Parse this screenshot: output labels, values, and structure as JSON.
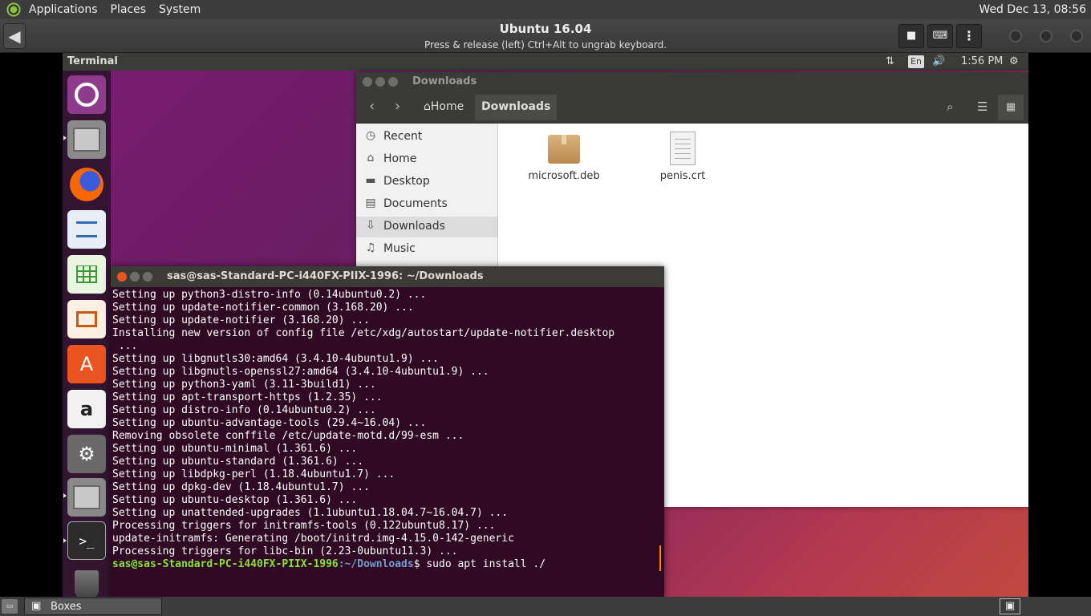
{
  "host_panel": {
    "menus": [
      "Applications",
      "Places",
      "System"
    ],
    "clock": "Wed Dec 13, 08:56"
  },
  "boxes_header": {
    "back_icon": "◀",
    "title": "Ubuntu 16.04",
    "subtitle": "Press & release (left) Ctrl+Alt to ungrab keyboard.",
    "buttons": {
      "stop": "■",
      "keyboard": "⌨",
      "menu": "⋮"
    }
  },
  "guest_panel": {
    "app_title": "Terminal",
    "network_icon": "⇅",
    "lang": "En",
    "volume_icon": "🔊",
    "time": "1:56 PM",
    "settings_icon": "⚙"
  },
  "files_window": {
    "title": "Downloads",
    "crumb_home": "Home",
    "crumb_current": "Downloads",
    "sidebar": [
      {
        "icon": "◷",
        "label": "Recent"
      },
      {
        "icon": "⌂",
        "label": "Home"
      },
      {
        "icon": "▬",
        "label": "Desktop"
      },
      {
        "icon": "▤",
        "label": "Documents"
      },
      {
        "icon": "⇩",
        "label": "Downloads"
      },
      {
        "icon": "♫",
        "label": "Music"
      }
    ],
    "files": [
      {
        "name": "microsoft.deb"
      },
      {
        "name": "penis.crt"
      }
    ]
  },
  "terminal": {
    "title": "sas@sas-Standard-PC-i440FX-PIIX-1996: ~/Downloads",
    "lines": [
      "Setting up python3-distro-info (0.14ubuntu0.2) ...",
      "Setting up update-notifier-common (3.168.20) ...",
      "Setting up update-notifier (3.168.20) ...",
      "Installing new version of config file /etc/xdg/autostart/update-notifier.desktop",
      " ...",
      "Setting up libgnutls30:amd64 (3.4.10-4ubuntu1.9) ...",
      "Setting up libgnutls-openssl27:amd64 (3.4.10-4ubuntu1.9) ...",
      "Setting up python3-yaml (3.11-3build1) ...",
      "Setting up apt-transport-https (1.2.35) ...",
      "Setting up distro-info (0.14ubuntu0.2) ...",
      "Setting up ubuntu-advantage-tools (29.4~16.04) ...",
      "Removing obsolete conffile /etc/update-motd.d/99-esm ...",
      "Setting up ubuntu-minimal (1.361.6) ...",
      "Setting up ubuntu-standard (1.361.6) ...",
      "Setting up libdpkg-perl (1.18.4ubuntu1.7) ...",
      "Setting up dpkg-dev (1.18.4ubuntu1.7) ...",
      "Setting up ubuntu-desktop (1.361.6) ...",
      "Setting up unattended-upgrades (1.1ubuntu1.18.04.7~16.04.7) ...",
      "Processing triggers for initramfs-tools (0.122ubuntu8.17) ...",
      "update-initramfs: Generating /boot/initrd.img-4.15.0-142-generic",
      "Processing triggers for libc-bin (2.23-0ubuntu11.3) ..."
    ],
    "prompt_user": "sas@sas-Standard-PC-i440FX-PIIX-1996",
    "prompt_path": ":~/Downloads",
    "prompt_cmd": "$ sudo apt install ./"
  },
  "host_bottom": {
    "show_desktop_label": "▭",
    "task_label": "Boxes",
    "task_icon": "▣",
    "workspace_icon": "▣"
  }
}
